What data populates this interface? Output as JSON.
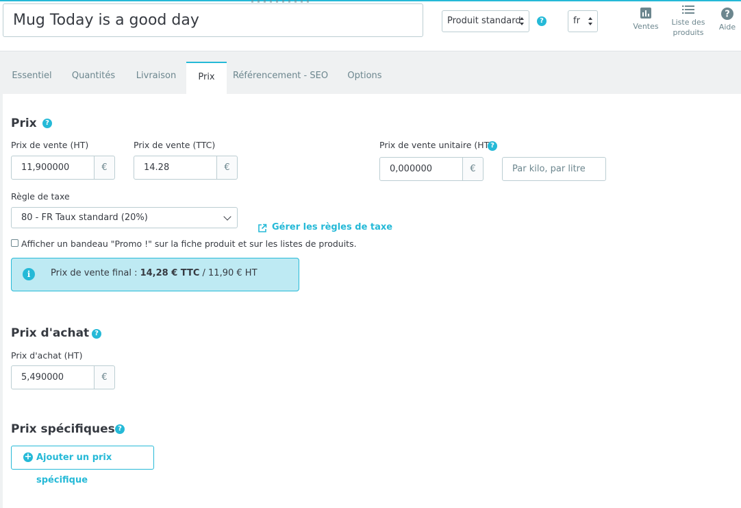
{
  "header": {
    "product_name": "Mug Today is a good day",
    "product_type": "Produit standard",
    "language": "fr",
    "actions": [
      {
        "label": "Ventes",
        "icon": "bar-chart-icon"
      },
      {
        "label_line1": "Liste des",
        "label_line2": "produits",
        "icon": "list-icon"
      },
      {
        "label": "Aide",
        "icon": "help-icon"
      }
    ]
  },
  "tabs": [
    {
      "label": "Essentiel"
    },
    {
      "label": "Quantités"
    },
    {
      "label": "Livraison"
    },
    {
      "label": "Prix",
      "active": true
    },
    {
      "label": "Référencement - SEO"
    },
    {
      "label": "Options"
    }
  ],
  "prix": {
    "title": "Prix",
    "ht_label": "Prix de vente (HT)",
    "ht_value": "11,900000",
    "ttc_label": "Prix de vente (TTC)",
    "ttc_value": "14.28",
    "currency": "€",
    "unit_label": "Prix de vente unitaire (HT)",
    "unit_value": "0,000000",
    "unit_placeholder": "Par kilo, par litre",
    "tax_rule_label": "Règle de taxe",
    "tax_rule_value": "80 - FR Taux standard (20%)",
    "manage_tax_link": "Gérer les règles de taxe",
    "promo_checkbox_label": "Afficher un bandeau \"Promo !\" sur la fiche produit et sur les listes de produits.",
    "final_price_prefix": "Prix de vente final : ",
    "final_price_ttc": "14,28 € TTC",
    "final_price_suffix": " / 11,90 € HT"
  },
  "achat": {
    "title": "Prix d'achat",
    "label": "Prix d'achat (HT)",
    "value": "5,490000",
    "currency": "€"
  },
  "specifiques": {
    "title": "Prix spécifiques",
    "add_button": "Ajouter un prix spécifique"
  },
  "colors": {
    "accent": "#25b9d7",
    "alert_bg": "#beeaf3",
    "text": "#363a41",
    "muted": "#6c868e"
  }
}
